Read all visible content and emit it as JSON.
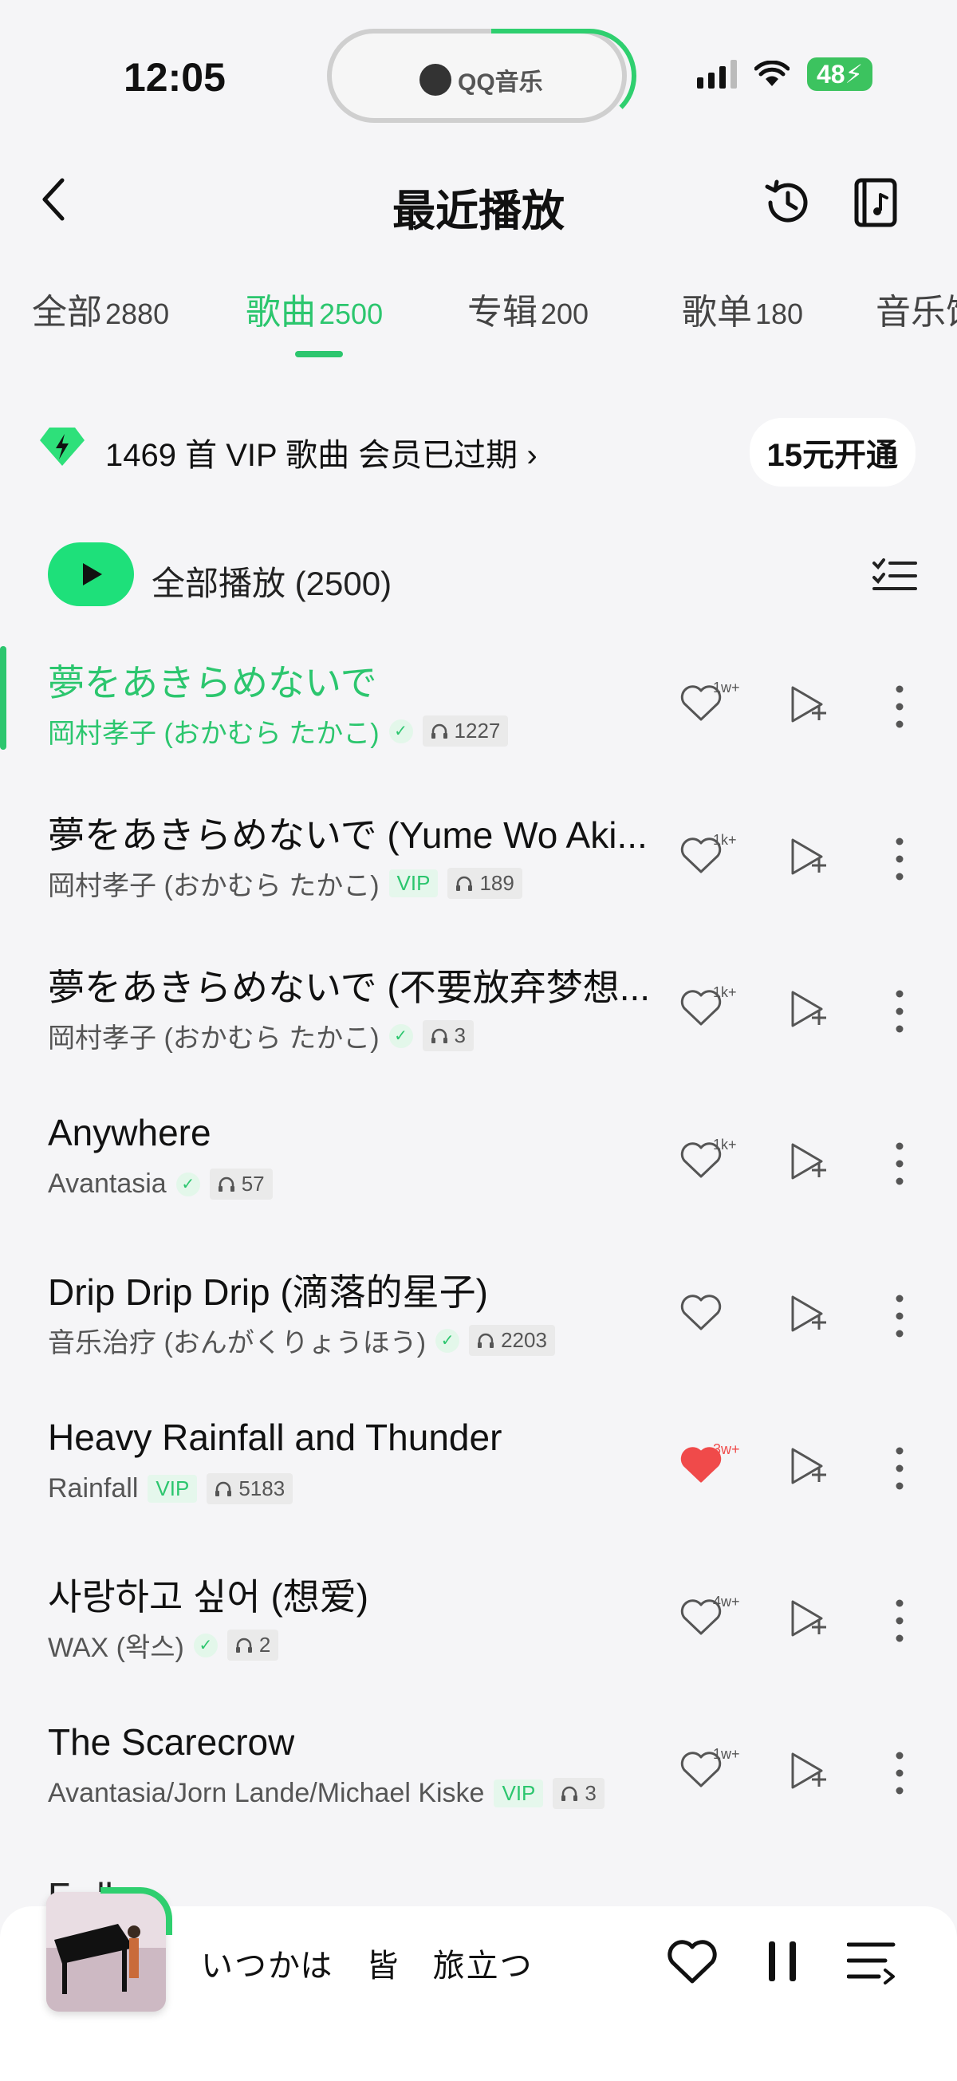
{
  "status": {
    "time": "12:05",
    "island_app": "QQ音乐",
    "battery": "48"
  },
  "header": {
    "title": "最近播放"
  },
  "tabs": [
    {
      "label": "全部",
      "count": "2880"
    },
    {
      "label": "歌曲",
      "count": "2500"
    },
    {
      "label": "专辑",
      "count": "200"
    },
    {
      "label": "歌单",
      "count": "180"
    },
    {
      "label": "音乐馆",
      "count": ""
    }
  ],
  "vip": {
    "text": "1469 首 VIP 歌曲 会员已过期",
    "button": "15元开通"
  },
  "play_all": {
    "label": "全部播放 (2500)"
  },
  "songs": [
    {
      "title": "夢をあきらめないで",
      "artist": "岡村孝子 (おかむら たかこ)",
      "badge": "check",
      "plays": "1227",
      "likes": "1w+",
      "liked": false,
      "playing": true
    },
    {
      "title": "夢をあきらめないで (Yume Wo Aki...",
      "artist": "岡村孝子 (おかむら たかこ)",
      "badge": "VIP",
      "plays": "189",
      "likes": "1k+",
      "liked": false,
      "playing": false
    },
    {
      "title": "夢をあきらめないで (不要放弃梦想...",
      "artist": "岡村孝子 (おかむら たかこ)",
      "badge": "check",
      "plays": "3",
      "likes": "1k+",
      "liked": false,
      "playing": false
    },
    {
      "title": "Anywhere",
      "artist": "Avantasia",
      "badge": "check",
      "plays": "57",
      "likes": "1k+",
      "liked": false,
      "playing": false
    },
    {
      "title": "Drip Drip Drip (滴落的星子)",
      "artist": "音乐治疗 (おんがくりょうほう)",
      "badge": "check",
      "plays": "2203",
      "likes": "",
      "liked": false,
      "playing": false
    },
    {
      "title": "Heavy Rainfall and Thunder",
      "artist": "Rainfall",
      "badge": "VIP",
      "plays": "5183",
      "likes": "3w+",
      "liked": true,
      "playing": false
    },
    {
      "title": "사랑하고 싶어 (想爱)",
      "artist": "WAX (왁스)",
      "badge": "check",
      "plays": "2",
      "likes": "4w+",
      "liked": false,
      "playing": false
    },
    {
      "title": "The Scarecrow",
      "artist": "Avantasia/Jorn Lande/Michael Kiske",
      "badge": "VIP",
      "plays": "3",
      "likes": "1w+",
      "liked": false,
      "playing": false
    }
  ],
  "partial_next": "F...ll",
  "player": {
    "title": "いつかは 皆 旅立つ"
  },
  "colors": {
    "accent": "#2cc66e",
    "liked": "#f04a4a",
    "background": "#f5f5f7"
  }
}
